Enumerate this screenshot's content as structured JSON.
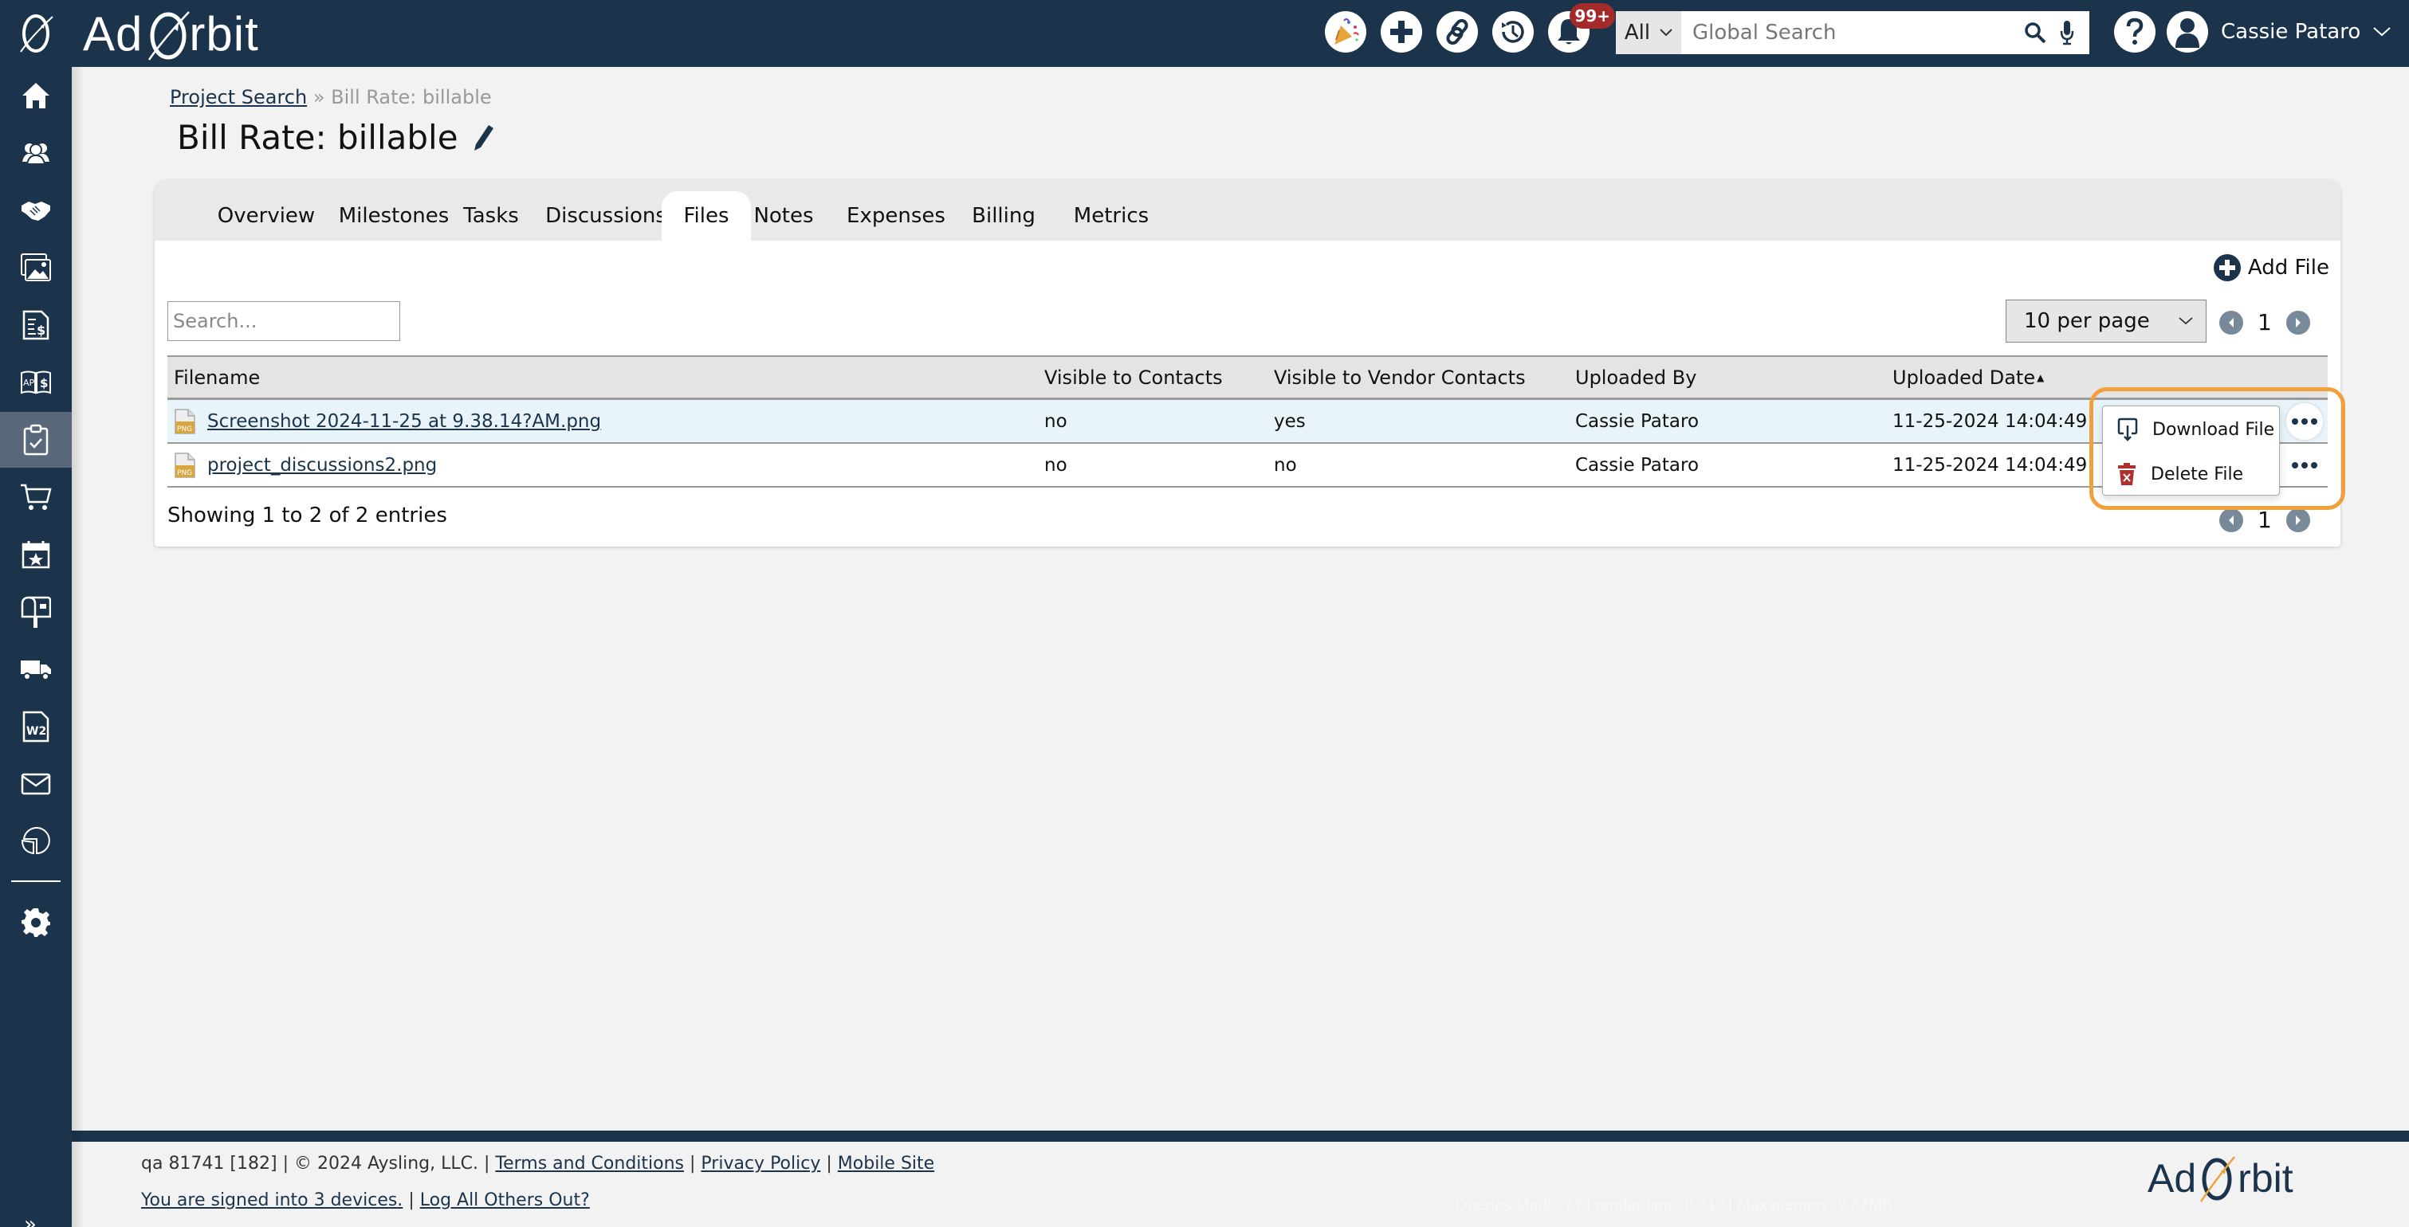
{
  "app": {
    "brand_left": "Ad",
    "brand_right": "rbit"
  },
  "header": {
    "icons": [
      "party-popper-icon",
      "plus-icon",
      "link-icon",
      "history-icon",
      "bell-icon"
    ],
    "notification_badge": "99+",
    "search_scope": "All",
    "search_placeholder": "Global Search",
    "user_name": "Cassie Pataro"
  },
  "sidebar": {
    "items": [
      {
        "name": "home",
        "icon": "home-icon"
      },
      {
        "name": "contacts",
        "icon": "people-icon"
      },
      {
        "name": "deals",
        "icon": "handshake-icon"
      },
      {
        "name": "media",
        "icon": "images-icon"
      },
      {
        "name": "invoices",
        "icon": "invoice-dollar-icon"
      },
      {
        "name": "ap",
        "icon": "ap-dollar-icon"
      },
      {
        "name": "projects",
        "icon": "clipboard-check-icon",
        "active": true
      },
      {
        "name": "orders",
        "icon": "cart-icon"
      },
      {
        "name": "calendar",
        "icon": "calendar-star-icon"
      },
      {
        "name": "mailbox",
        "icon": "mailbox-icon"
      },
      {
        "name": "delivery",
        "icon": "truck-icon"
      },
      {
        "name": "w2",
        "icon": "w2-icon"
      },
      {
        "name": "email",
        "icon": "envelope-icon"
      },
      {
        "name": "reports",
        "icon": "pie-chart-icon"
      }
    ],
    "settings_icon": "gear-icon",
    "expand_label": "»"
  },
  "breadcrumb": {
    "parent": "Project Search",
    "separator": "»",
    "current": "Bill Rate: billable"
  },
  "page": {
    "title": "Bill Rate: billable"
  },
  "tabs": [
    {
      "label": "Overview"
    },
    {
      "label": "Milestones"
    },
    {
      "label": "Tasks"
    },
    {
      "label": "Discussions"
    },
    {
      "label": "Files",
      "active": true
    },
    {
      "label": "Notes"
    },
    {
      "label": "Expenses"
    },
    {
      "label": "Billing"
    },
    {
      "label": "Metrics"
    }
  ],
  "files": {
    "add_label": "Add File",
    "search_placeholder": "Search...",
    "per_page": "10 per page",
    "page": "1",
    "columns": [
      "Filename",
      "Visible to Contacts",
      "Visible to Vendor Contacts",
      "Uploaded By",
      "Uploaded Date"
    ],
    "sort_indicator": "▲",
    "rows": [
      {
        "filename": "Screenshot 2024-11-25 at 9.38.14?AM.png",
        "visible_contacts": "no",
        "visible_vendor": "yes",
        "uploaded_by": "Cassie Pataro",
        "uploaded_date": "11-25-2024 14:04:49"
      },
      {
        "filename": "project_discussions2.png",
        "visible_contacts": "no",
        "visible_vendor": "no",
        "uploaded_by": "Cassie Pataro",
        "uploaded_date": "11-25-2024 14:04:49"
      }
    ],
    "showing": "Showing 1 to 2 of 2 entries",
    "file_type_label": "PNG"
  },
  "row_menu": {
    "items": [
      {
        "label": "Download File",
        "icon": "download-icon"
      },
      {
        "label": "Delete File",
        "icon": "trash-icon"
      }
    ]
  },
  "footer": {
    "build": "qa 81741 [182] | © 2024 Aysling, LLC. |",
    "terms": "Terms and Conditions",
    "privacy": "Privacy Policy",
    "mobile": "Mobile Site",
    "sep": "|",
    "devices": "You are signed into 3 devices.",
    "logout": "Log All Others Out?",
    "perf": "Queries Made: 77 | render time: 0.31s | Max memory: 9.87MB"
  }
}
